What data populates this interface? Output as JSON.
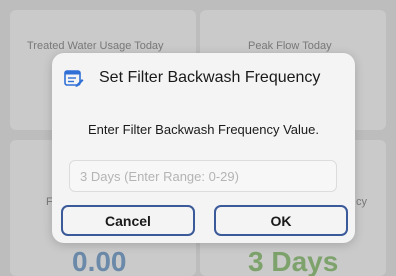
{
  "background": {
    "card_top_left_title": "Treated Water Usage Today",
    "card_top_right_title": "Peak Flow Today",
    "card_bottom_left_value": "0.00",
    "card_bottom_right_value": "3 Days",
    "card_bottom_left_fragment": "F",
    "card_bottom_right_fragment": "cy"
  },
  "dialog": {
    "icon": "edit-list-icon",
    "title": "Set Filter Backwash Frequency",
    "message": "Enter Filter Backwash Frequency Value.",
    "input_value": "",
    "input_placeholder": "3 Days (Enter Range: 0-29)",
    "cancel_label": "Cancel",
    "ok_label": "OK"
  },
  "colors": {
    "accent": "#3b5a9a",
    "icon_blue": "#2f6fd6"
  }
}
